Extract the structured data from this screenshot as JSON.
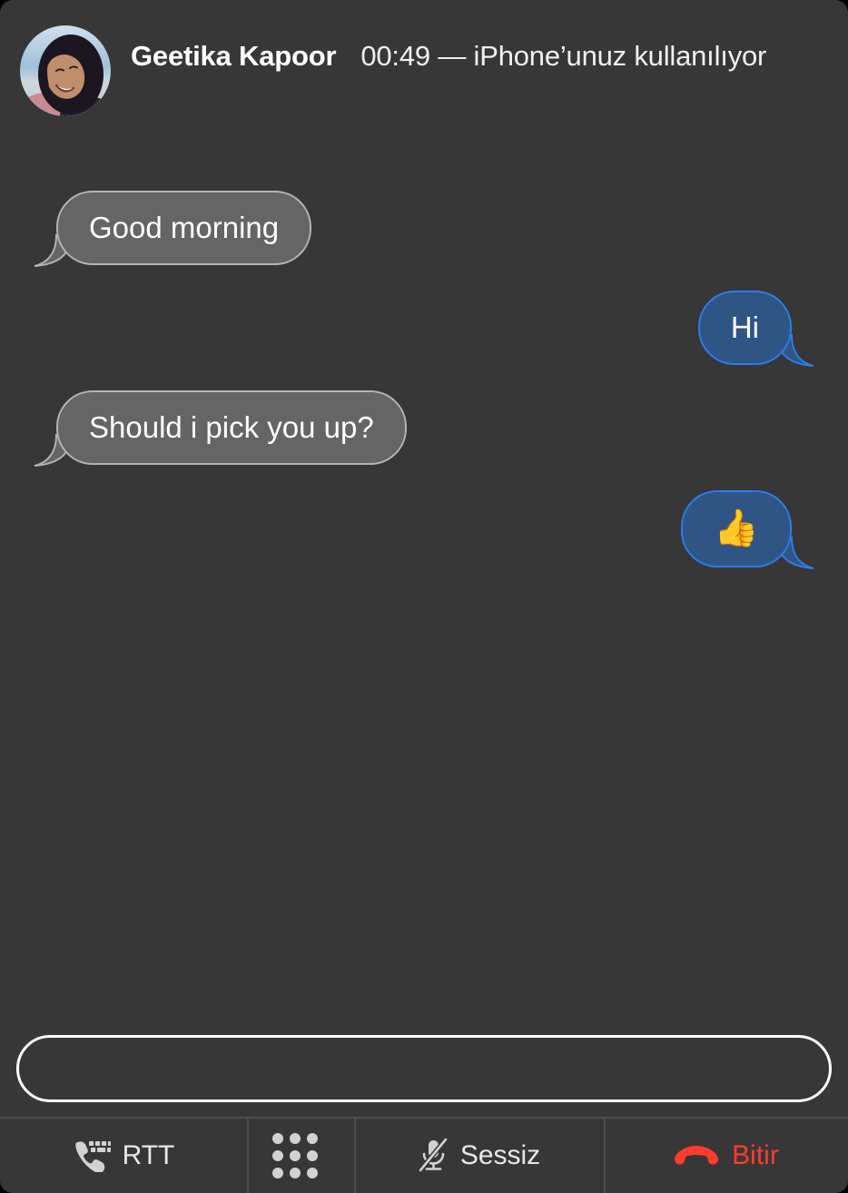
{
  "window": {
    "background_color": "#373737",
    "corner_radius_px": 14
  },
  "header": {
    "avatar_name": "contact-avatar-photo",
    "caller_name": "Geetika Kapoor",
    "call_status": "00:49 — iPhone’unuz kullanılıyor",
    "duration": "00:49",
    "device_note": "iPhone’unuz kullanılıyor"
  },
  "transcript": {
    "messages": [
      {
        "id": 1,
        "direction": "incoming",
        "type": "text",
        "text": "Good morning"
      },
      {
        "id": 2,
        "direction": "outgoing",
        "type": "text",
        "text": "Hi"
      },
      {
        "id": 3,
        "direction": "incoming",
        "type": "text",
        "text": "Should i pick you up?"
      },
      {
        "id": 4,
        "direction": "outgoing",
        "type": "emoji",
        "text": "👍",
        "emoji_name": "thumbs-up-emoji"
      }
    ],
    "incoming_bubble_color": "#656565",
    "incoming_bubble_border": "#b4b4b4",
    "outgoing_bubble_color": "#2f5584",
    "outgoing_bubble_border": "#2f7ce8"
  },
  "rtt_input": {
    "value": "",
    "placeholder": ""
  },
  "toolbar": {
    "items": [
      {
        "key": "rtt",
        "label": "RTT",
        "icon": "phone-keyboard-icon",
        "color": "#e8e8e8"
      },
      {
        "key": "keypad",
        "label": "",
        "icon": "keypad-icon",
        "color": "#d2d2d2"
      },
      {
        "key": "mute",
        "label": "Sessiz",
        "icon": "microphone-muted-icon",
        "color": "#e8e8e8"
      },
      {
        "key": "end",
        "label": "Bitir",
        "icon": "end-call-icon",
        "color": "#ff3b30"
      }
    ]
  }
}
